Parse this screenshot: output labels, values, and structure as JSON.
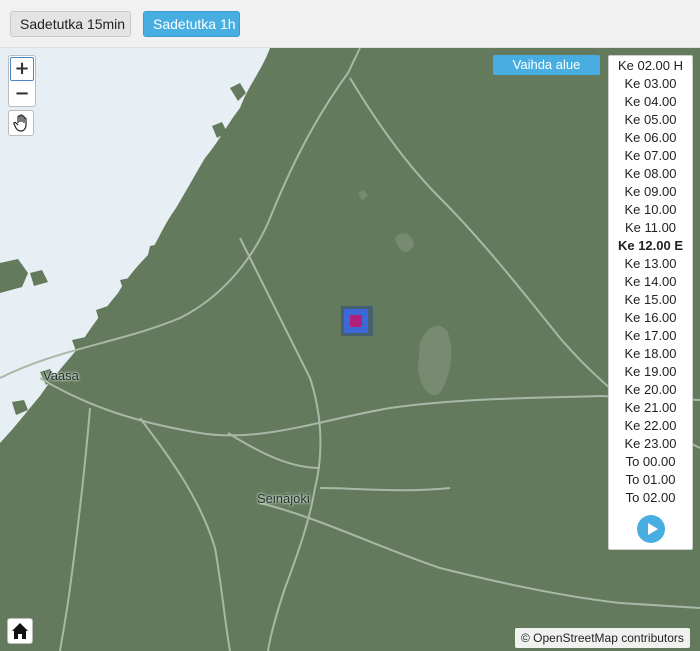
{
  "tabs": [
    {
      "label": "Sadetutka 15min",
      "active": false
    },
    {
      "label": "Sadetutka 1h",
      "active": true
    }
  ],
  "map": {
    "zoom_in_label": "+",
    "zoom_out_label": "−",
    "pan_icon": "hand-pan-icon",
    "home_icon": "home-icon",
    "change_area_label": "Vaihda alue",
    "cities": [
      {
        "name": "Vaasa"
      },
      {
        "name": "Seinäjoki"
      }
    ],
    "attribution": "© OpenStreetMap contributors",
    "colors": {
      "land": "#637b5c",
      "sea": "#e7eef4",
      "roads": "#a9b8a6",
      "radar_outer": "#3d68d8",
      "radar_core": "#b0207a",
      "accent": "#48ade0"
    }
  },
  "time_panel": {
    "items": [
      "Ke 02.00 H",
      "Ke 03.00",
      "Ke 04.00",
      "Ke 05.00",
      "Ke 06.00",
      "Ke 07.00",
      "Ke 08.00",
      "Ke 09.00",
      "Ke 10.00",
      "Ke 11.00",
      "Ke 12.00 E",
      "Ke 13.00",
      "Ke 14.00",
      "Ke 15.00",
      "Ke 16.00",
      "Ke 17.00",
      "Ke 18.00",
      "Ke 19.00",
      "Ke 20.00",
      "Ke 21.00",
      "Ke 22.00",
      "Ke 23.00",
      "To 00.00",
      "To 01.00",
      "To 02.00"
    ],
    "current_index": 10,
    "play_icon": "play-icon"
  }
}
